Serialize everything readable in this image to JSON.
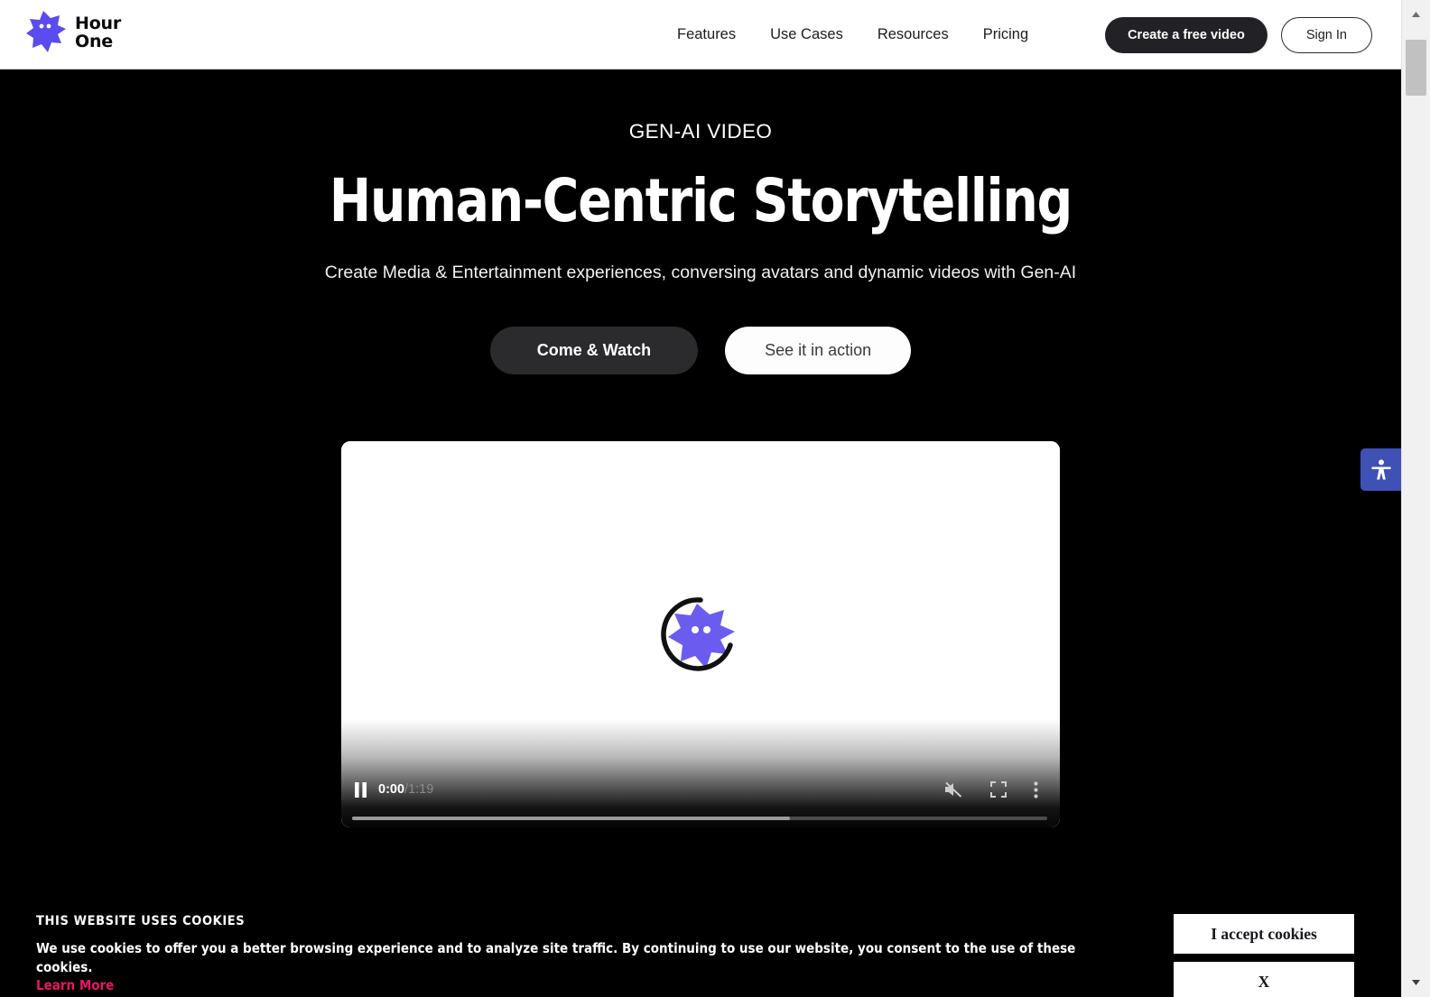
{
  "header": {
    "brand": {
      "line1": "Hour",
      "line2": "One",
      "logo_icon": "hourone-star-avatar-logo",
      "logo_color": "#5b4cf0"
    },
    "nav": [
      {
        "label": "Features"
      },
      {
        "label": "Use Cases"
      },
      {
        "label": "Resources"
      },
      {
        "label": "Pricing"
      }
    ],
    "create_button": "Create a free video",
    "signin_button": "Sign In"
  },
  "hero": {
    "eyebrow": "GEN-AI VIDEO",
    "title": "Human-Centric Storytelling",
    "subtitle": "Create Media & Entertainment experiences, conversing avatars and dynamic videos with Gen-AI",
    "primary_cta": "Come & Watch",
    "secondary_cta": "See it in action"
  },
  "video": {
    "state": "loading",
    "play_pause_icon": "pause-icon",
    "current_time": "0:00",
    "time_separator": "/",
    "duration": "1:19",
    "mute_icon": "volume-muted-icon",
    "fullscreen_icon": "fullscreen-icon",
    "more_options_icon": "more-vertical-icon",
    "progress_percent": 0,
    "buffered_percent": 63,
    "loading_icon": "hourone-spinner-logo"
  },
  "accessibility": {
    "icon": "accessibility-person-icon",
    "background_color": "#3f51b5"
  },
  "cookies": {
    "title": "THIS WEBSITE USES COOKIES",
    "body": "We use cookies to offer you a better browsing experience and to analyze site traffic. By continuing to use our website, you consent to the use of these cookies.",
    "learn_more": "Learn More",
    "learn_more_color": "#ec1464",
    "accept_button": "I accept cookies",
    "close_button": "X"
  },
  "scrollbar": {
    "up_icon": "scroll-up-arrow-icon",
    "down_icon": "scroll-down-arrow-icon"
  }
}
